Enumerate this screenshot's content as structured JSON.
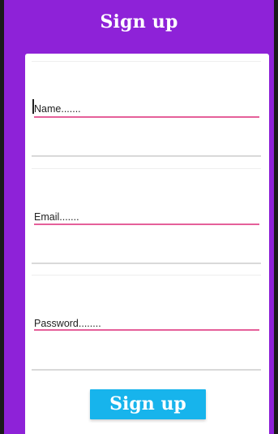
{
  "header": {
    "title": "Sign up"
  },
  "form": {
    "name_label": "Name.......",
    "email_label": "Email.......",
    "password_label": "Password........",
    "submit_label": "Sign up"
  },
  "colors": {
    "header_background": "#8e22d8",
    "field_underline": "#e5609a",
    "button_background": "#17b4ec"
  }
}
